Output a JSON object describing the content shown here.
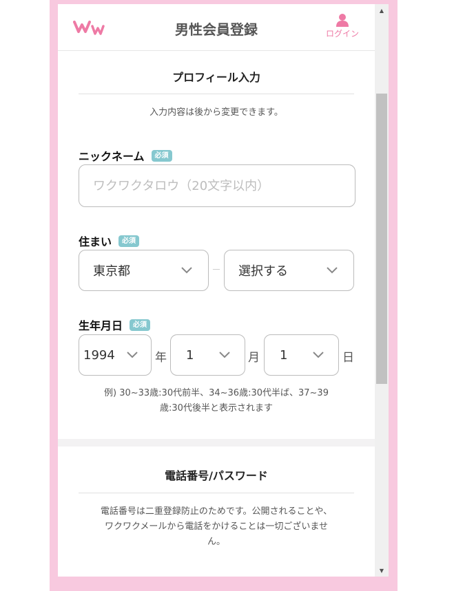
{
  "header": {
    "title": "男性会員登録",
    "login_label": "ログイン",
    "logo_color": "#ee7aa5"
  },
  "profile": {
    "section_title": "プロフィール入力",
    "note": "入力内容は後から変更できます。",
    "required_badge": "必須",
    "nickname": {
      "label": "ニックネーム",
      "placeholder": "ワクワクタロウ（20文字以内）",
      "value": ""
    },
    "residence": {
      "label": "住まい",
      "prefecture": "東京都",
      "separator": "－",
      "city": "選択する"
    },
    "birthday": {
      "label": "生年月日",
      "year": "1994",
      "year_unit": "年",
      "month": "1",
      "month_unit": "月",
      "day": "1",
      "day_unit": "日",
      "example_line1": "例) 30~33歳:30代前半、34~36歳:30代半ば、37~39",
      "example_line2": "歳:30代後半と表示されます"
    }
  },
  "phone_section": {
    "title": "電話番号/パスワード",
    "note_line1": "電話番号は二重登録防止のためです。公開されることや、",
    "note_line2": "ワクワクメールから電話をかけることは一切ございませ",
    "note_line3": "ん。"
  },
  "colors": {
    "frame": "#f8c9df",
    "accent": "#ee7aa5",
    "badge": "#86c8cf"
  }
}
